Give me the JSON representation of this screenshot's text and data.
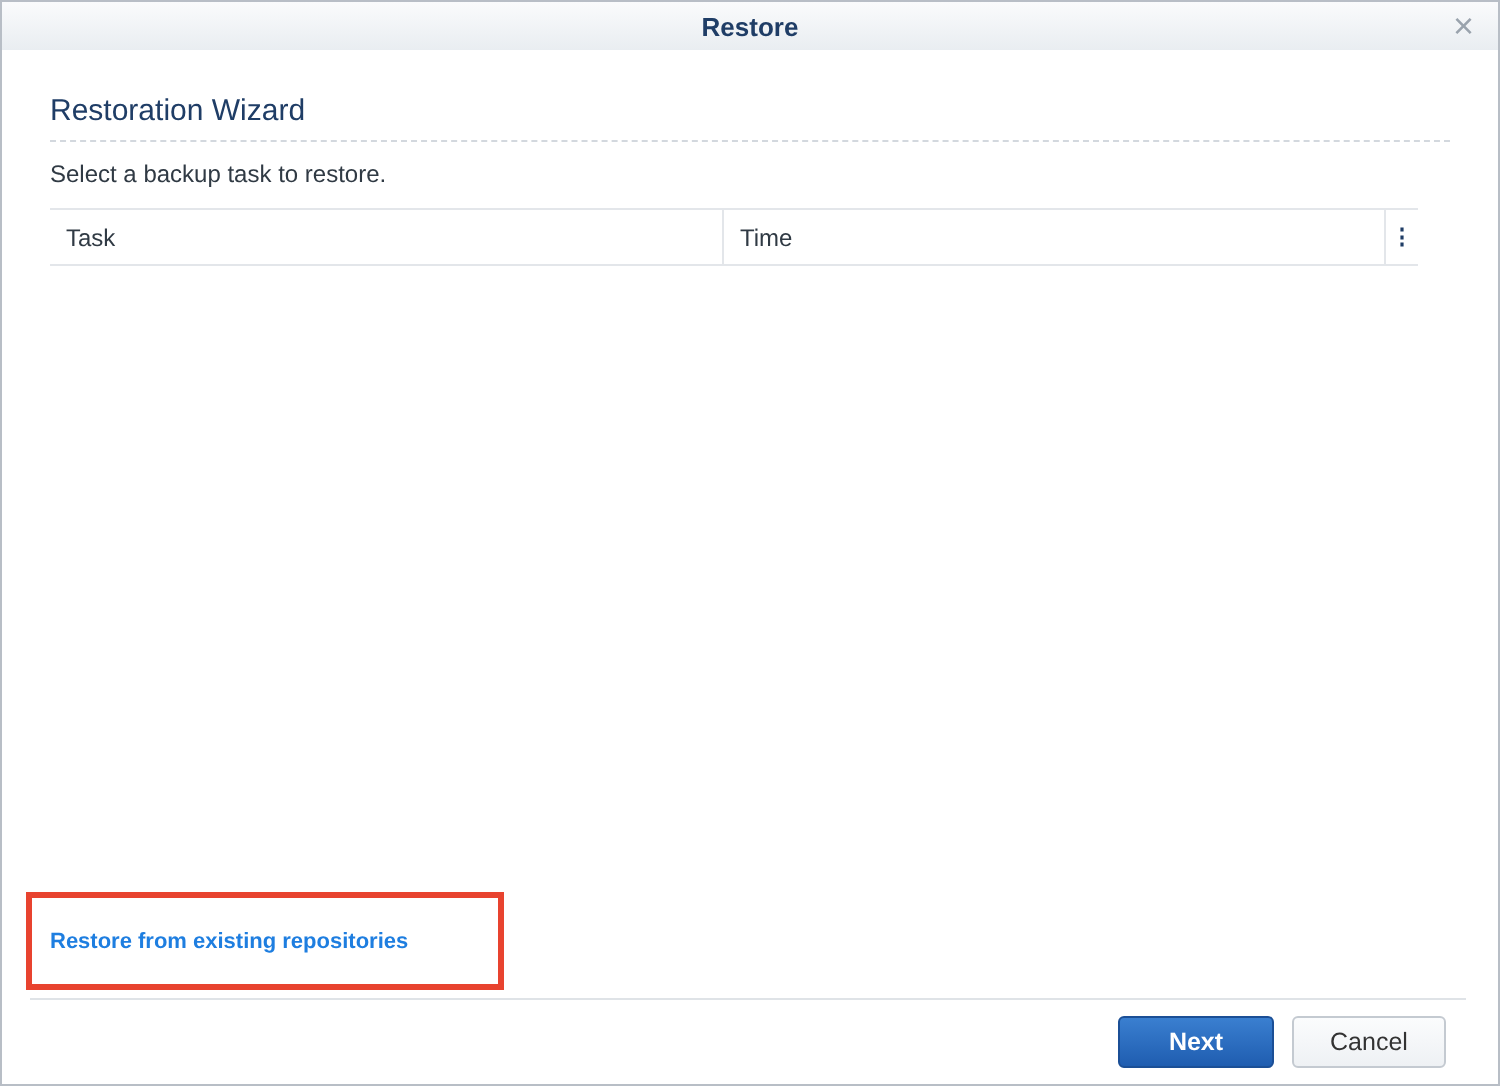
{
  "window": {
    "title": "Restore",
    "close": "×"
  },
  "wizard": {
    "title": "Restoration Wizard",
    "instruction": "Select a backup task to restore."
  },
  "table": {
    "columns": [
      "Task",
      "Time"
    ],
    "menu": "⋮"
  },
  "link": {
    "label": "Restore from existing repositories",
    "highlighted": true
  },
  "buttons": [
    {
      "label": "Next",
      "kind": "primary"
    },
    {
      "label": "Cancel",
      "kind": "secondary"
    }
  ]
}
